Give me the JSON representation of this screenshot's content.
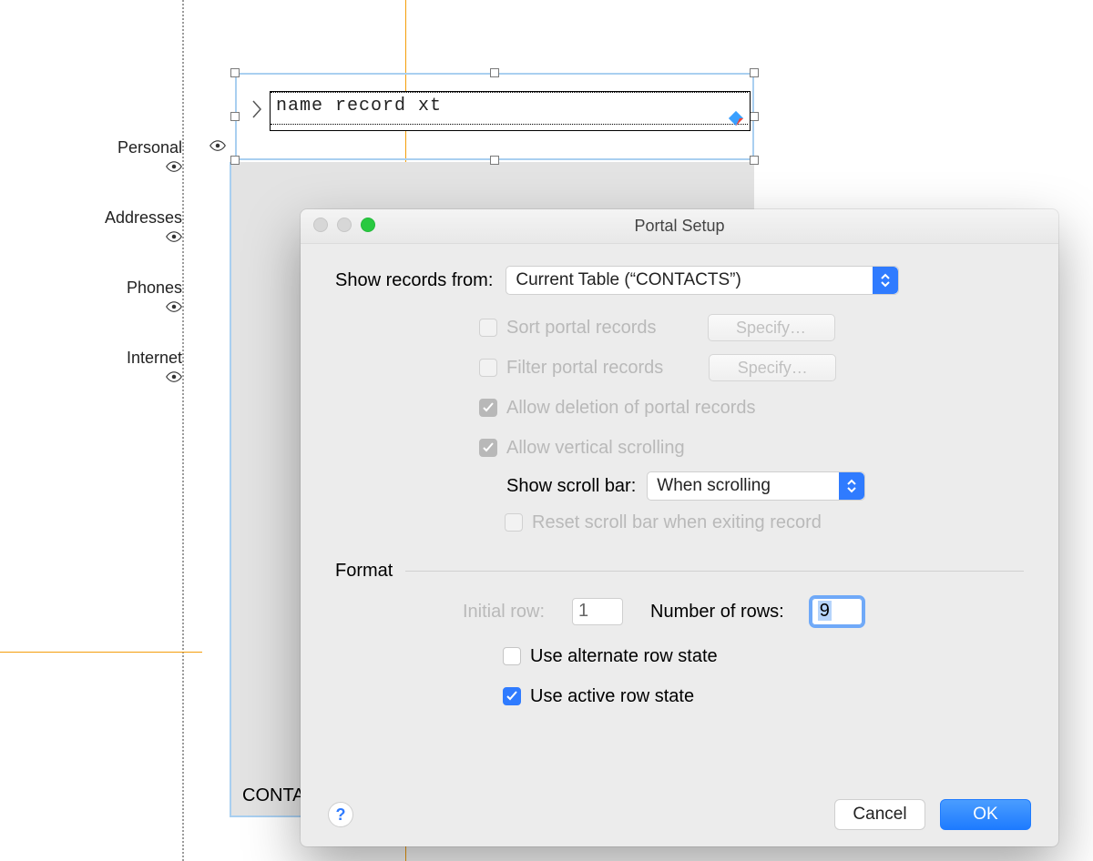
{
  "canvas": {
    "row_placeholder": "name record xt",
    "portal_label": "CONTA"
  },
  "sidebar": {
    "items": [
      {
        "label": "Personal"
      },
      {
        "label": "Addresses"
      },
      {
        "label": "Phones"
      },
      {
        "label": "Internet"
      }
    ]
  },
  "dialog": {
    "title": "Portal Setup",
    "records_label": "Show records from:",
    "records_value": "Current Table (“CONTACTS”)",
    "sort_label": "Sort portal records",
    "filter_label": "Filter portal records",
    "specify_label": "Specify…",
    "allow_delete_label": "Allow deletion of portal records",
    "allow_vscroll_label": "Allow vertical scrolling",
    "show_scroll_label": "Show scroll bar:",
    "show_scroll_value": "When scrolling",
    "reset_scroll_label": "Reset scroll bar when exiting record",
    "section_format": "Format",
    "initial_row_label": "Initial row:",
    "initial_row_value": "1",
    "num_rows_label": "Number of rows:",
    "num_rows_value": "9",
    "use_alt_row_label": "Use alternate row state",
    "use_active_row_label": "Use active row state",
    "help_label": "?",
    "cancel_label": "Cancel",
    "ok_label": "OK"
  }
}
